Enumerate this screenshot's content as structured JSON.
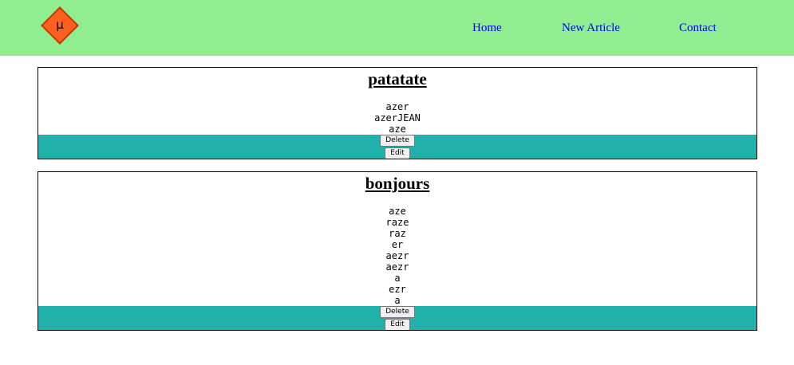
{
  "header": {
    "logo_icon": "mu-diamond-logo-icon",
    "logo_letter": "μ",
    "colors": {
      "background": "#90ee90",
      "logo_fill": "#ff5f1f",
      "logo_border": "#c43c00",
      "link": "#0000ee"
    },
    "nav": [
      {
        "label": "Home"
      },
      {
        "label": "New Article"
      },
      {
        "label": "Contact"
      }
    ]
  },
  "articles": [
    {
      "title": "patatate",
      "body_lines": [
        "azer",
        "azerJEAN",
        "aze"
      ],
      "delete_label": "Delete",
      "edit_label": "Edit"
    },
    {
      "title": "bonjours",
      "body_lines": [
        "aze",
        "raze",
        "raz",
        "er",
        "aezr",
        "aezr",
        "a",
        "ezr",
        "a"
      ],
      "delete_label": "Delete",
      "edit_label": "Edit"
    }
  ],
  "colors": {
    "article_footer": "#20b2aa",
    "article_border": "#000000"
  }
}
